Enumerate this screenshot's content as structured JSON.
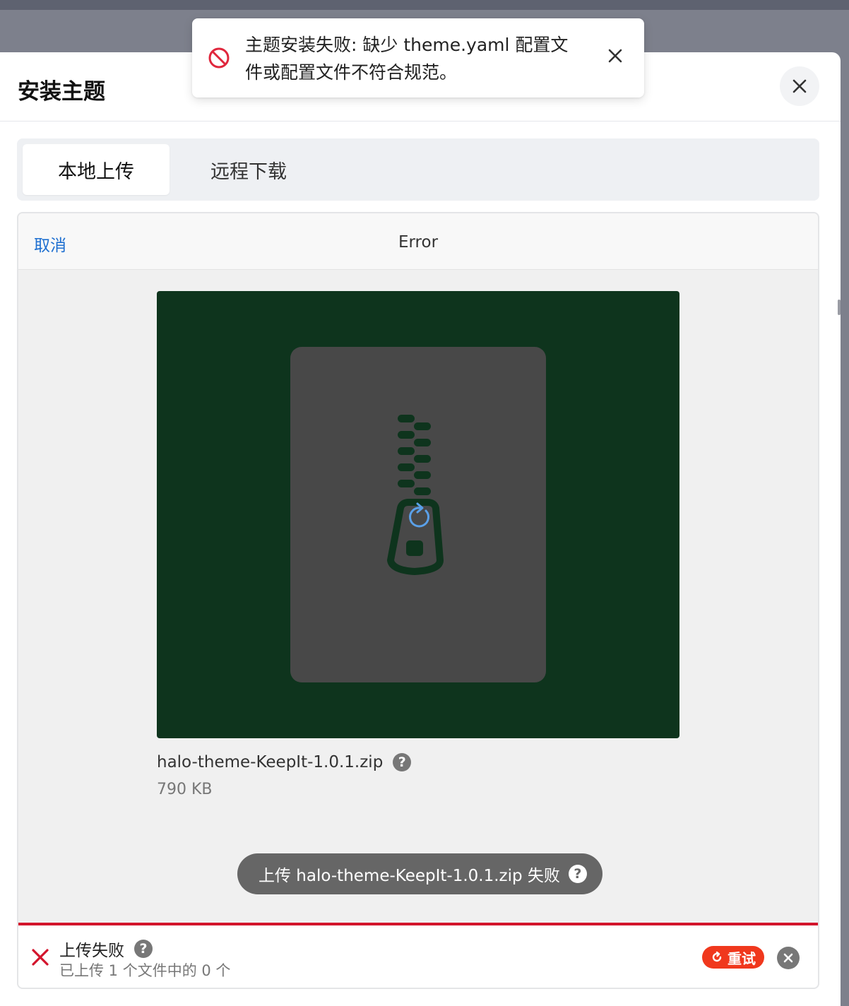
{
  "dialog": {
    "title": "安装主题"
  },
  "tabs": [
    {
      "label": "本地上传",
      "active": true
    },
    {
      "label": "远程下载",
      "active": false
    }
  ],
  "uploader": {
    "cancel_label": "取消",
    "header_title": "Error",
    "file": {
      "name": "halo-theme-KeepIt-1.0.1.zip",
      "size": "790 KB"
    },
    "error_message": "上传 halo-theme-KeepIt-1.0.1.zip 失败",
    "status": {
      "title": "上传失败",
      "subtitle": "已上传 1 个文件中的 0 个",
      "retry_label": "重试"
    }
  },
  "toast": {
    "message": "主题安装失败: 缺少 theme.yaml 配置文件或配置文件不符合规范。"
  },
  "colors": {
    "preview_bg": "#0e341d",
    "error_red": "#d3142c",
    "retry_bg": "#f0381d",
    "link_blue": "#1e6fd0"
  },
  "icons": {
    "toast": "prohibited-icon",
    "close": "close-icon",
    "file": "zip-archive-icon",
    "help": "question-icon",
    "status": "x-mark-icon",
    "retry": "refresh-icon"
  }
}
